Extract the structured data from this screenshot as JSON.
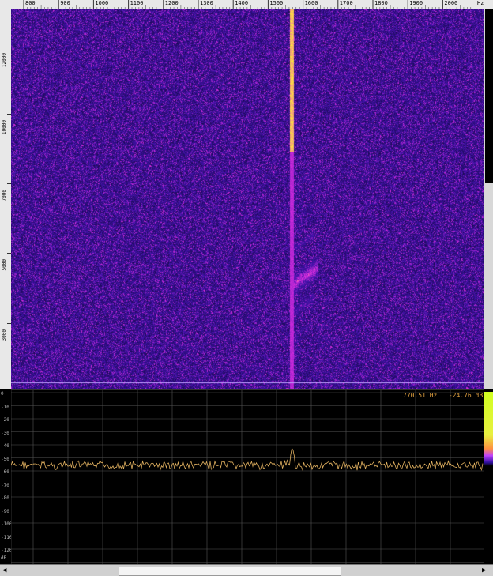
{
  "freq_ruler": {
    "labels": [
      "800",
      "900",
      "1000",
      "1100",
      "1200",
      "1300",
      "1400",
      "1500",
      "1600",
      "1700",
      "1800",
      "1900",
      "2000"
    ],
    "unit": "Hz"
  },
  "time_ruler": {
    "labels": [
      "12000",
      "10000",
      "7000",
      "5000",
      "3000"
    ]
  },
  "db_ruler": {
    "labels": [
      "0",
      "-10",
      "-20",
      "-30",
      "-40",
      "-50",
      "-60",
      "-70",
      "-80",
      "-90",
      "-100",
      "-110",
      "-120"
    ],
    "unit": "dB"
  },
  "readout": {
    "frequency": "770.51 Hz",
    "level": "-24.76 dB"
  },
  "colors": {
    "waterfall_bg": "#1a0850",
    "signal": "#ffd040",
    "trace": "#e0b060",
    "grid": "#555555"
  },
  "icons": {
    "scroll_left": "triangle-left",
    "scroll_right": "triangle-right"
  }
}
